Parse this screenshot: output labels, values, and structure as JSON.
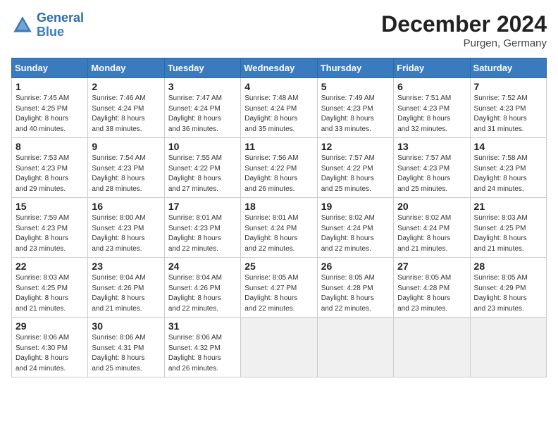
{
  "header": {
    "logo_line1": "General",
    "logo_line2": "Blue",
    "month_title": "December 2024",
    "location": "Purgen, Germany"
  },
  "weekdays": [
    "Sunday",
    "Monday",
    "Tuesday",
    "Wednesday",
    "Thursday",
    "Friday",
    "Saturday"
  ],
  "weeks": [
    [
      {
        "day": "1",
        "sunrise": "Sunrise: 7:45 AM",
        "sunset": "Sunset: 4:25 PM",
        "daylight": "Daylight: 8 hours and 40 minutes."
      },
      {
        "day": "2",
        "sunrise": "Sunrise: 7:46 AM",
        "sunset": "Sunset: 4:24 PM",
        "daylight": "Daylight: 8 hours and 38 minutes."
      },
      {
        "day": "3",
        "sunrise": "Sunrise: 7:47 AM",
        "sunset": "Sunset: 4:24 PM",
        "daylight": "Daylight: 8 hours and 36 minutes."
      },
      {
        "day": "4",
        "sunrise": "Sunrise: 7:48 AM",
        "sunset": "Sunset: 4:24 PM",
        "daylight": "Daylight: 8 hours and 35 minutes."
      },
      {
        "day": "5",
        "sunrise": "Sunrise: 7:49 AM",
        "sunset": "Sunset: 4:23 PM",
        "daylight": "Daylight: 8 hours and 33 minutes."
      },
      {
        "day": "6",
        "sunrise": "Sunrise: 7:51 AM",
        "sunset": "Sunset: 4:23 PM",
        "daylight": "Daylight: 8 hours and 32 minutes."
      },
      {
        "day": "7",
        "sunrise": "Sunrise: 7:52 AM",
        "sunset": "Sunset: 4:23 PM",
        "daylight": "Daylight: 8 hours and 31 minutes."
      }
    ],
    [
      {
        "day": "8",
        "sunrise": "Sunrise: 7:53 AM",
        "sunset": "Sunset: 4:23 PM",
        "daylight": "Daylight: 8 hours and 29 minutes."
      },
      {
        "day": "9",
        "sunrise": "Sunrise: 7:54 AM",
        "sunset": "Sunset: 4:23 PM",
        "daylight": "Daylight: 8 hours and 28 minutes."
      },
      {
        "day": "10",
        "sunrise": "Sunrise: 7:55 AM",
        "sunset": "Sunset: 4:22 PM",
        "daylight": "Daylight: 8 hours and 27 minutes."
      },
      {
        "day": "11",
        "sunrise": "Sunrise: 7:56 AM",
        "sunset": "Sunset: 4:22 PM",
        "daylight": "Daylight: 8 hours and 26 minutes."
      },
      {
        "day": "12",
        "sunrise": "Sunrise: 7:57 AM",
        "sunset": "Sunset: 4:22 PM",
        "daylight": "Daylight: 8 hours and 25 minutes."
      },
      {
        "day": "13",
        "sunrise": "Sunrise: 7:57 AM",
        "sunset": "Sunset: 4:23 PM",
        "daylight": "Daylight: 8 hours and 25 minutes."
      },
      {
        "day": "14",
        "sunrise": "Sunrise: 7:58 AM",
        "sunset": "Sunset: 4:23 PM",
        "daylight": "Daylight: 8 hours and 24 minutes."
      }
    ],
    [
      {
        "day": "15",
        "sunrise": "Sunrise: 7:59 AM",
        "sunset": "Sunset: 4:23 PM",
        "daylight": "Daylight: 8 hours and 23 minutes."
      },
      {
        "day": "16",
        "sunrise": "Sunrise: 8:00 AM",
        "sunset": "Sunset: 4:23 PM",
        "daylight": "Daylight: 8 hours and 23 minutes."
      },
      {
        "day": "17",
        "sunrise": "Sunrise: 8:01 AM",
        "sunset": "Sunset: 4:23 PM",
        "daylight": "Daylight: 8 hours and 22 minutes."
      },
      {
        "day": "18",
        "sunrise": "Sunrise: 8:01 AM",
        "sunset": "Sunset: 4:24 PM",
        "daylight": "Daylight: 8 hours and 22 minutes."
      },
      {
        "day": "19",
        "sunrise": "Sunrise: 8:02 AM",
        "sunset": "Sunset: 4:24 PM",
        "daylight": "Daylight: 8 hours and 22 minutes."
      },
      {
        "day": "20",
        "sunrise": "Sunrise: 8:02 AM",
        "sunset": "Sunset: 4:24 PM",
        "daylight": "Daylight: 8 hours and 21 minutes."
      },
      {
        "day": "21",
        "sunrise": "Sunrise: 8:03 AM",
        "sunset": "Sunset: 4:25 PM",
        "daylight": "Daylight: 8 hours and 21 minutes."
      }
    ],
    [
      {
        "day": "22",
        "sunrise": "Sunrise: 8:03 AM",
        "sunset": "Sunset: 4:25 PM",
        "daylight": "Daylight: 8 hours and 21 minutes."
      },
      {
        "day": "23",
        "sunrise": "Sunrise: 8:04 AM",
        "sunset": "Sunset: 4:26 PM",
        "daylight": "Daylight: 8 hours and 21 minutes."
      },
      {
        "day": "24",
        "sunrise": "Sunrise: 8:04 AM",
        "sunset": "Sunset: 4:26 PM",
        "daylight": "Daylight: 8 hours and 22 minutes."
      },
      {
        "day": "25",
        "sunrise": "Sunrise: 8:05 AM",
        "sunset": "Sunset: 4:27 PM",
        "daylight": "Daylight: 8 hours and 22 minutes."
      },
      {
        "day": "26",
        "sunrise": "Sunrise: 8:05 AM",
        "sunset": "Sunset: 4:28 PM",
        "daylight": "Daylight: 8 hours and 22 minutes."
      },
      {
        "day": "27",
        "sunrise": "Sunrise: 8:05 AM",
        "sunset": "Sunset: 4:28 PM",
        "daylight": "Daylight: 8 hours and 23 minutes."
      },
      {
        "day": "28",
        "sunrise": "Sunrise: 8:05 AM",
        "sunset": "Sunset: 4:29 PM",
        "daylight": "Daylight: 8 hours and 23 minutes."
      }
    ],
    [
      {
        "day": "29",
        "sunrise": "Sunrise: 8:06 AM",
        "sunset": "Sunset: 4:30 PM",
        "daylight": "Daylight: 8 hours and 24 minutes."
      },
      {
        "day": "30",
        "sunrise": "Sunrise: 8:06 AM",
        "sunset": "Sunset: 4:31 PM",
        "daylight": "Daylight: 8 hours and 25 minutes."
      },
      {
        "day": "31",
        "sunrise": "Sunrise: 8:06 AM",
        "sunset": "Sunset: 4:32 PM",
        "daylight": "Daylight: 8 hours and 26 minutes."
      },
      null,
      null,
      null,
      null
    ]
  ]
}
